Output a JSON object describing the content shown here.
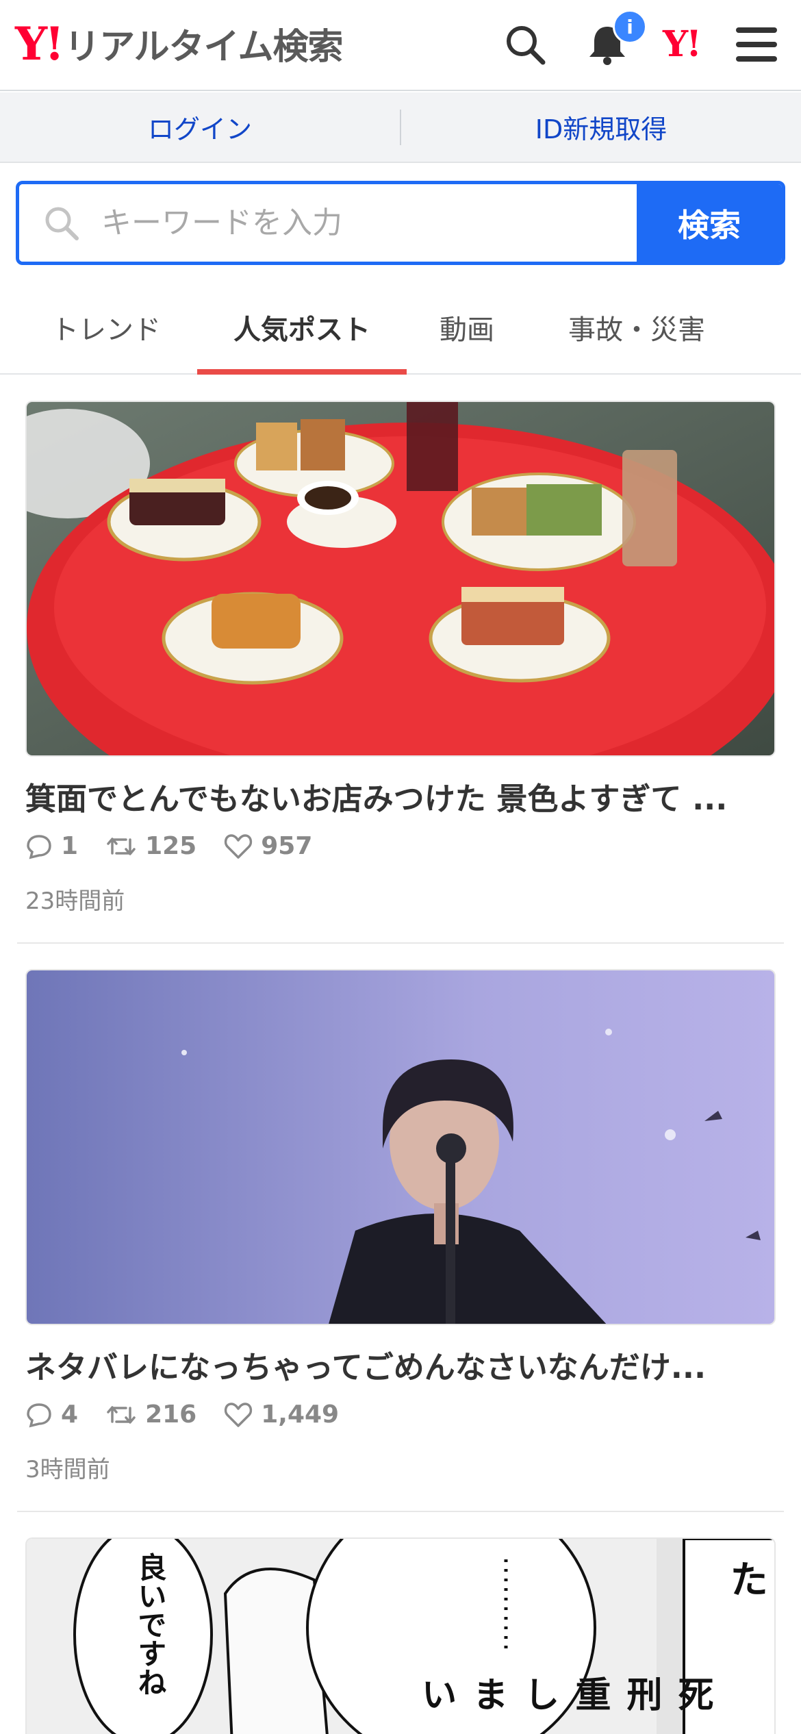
{
  "header": {
    "logo_mark": "Y!",
    "logo_text": "リアルタイム検索",
    "notification_badge": "i",
    "yahoo_mark": "Y!"
  },
  "login_bar": {
    "login": "ログイン",
    "register": "ID新規取得"
  },
  "search": {
    "placeholder": "キーワードを入力",
    "button": "検索"
  },
  "tabs": [
    {
      "label": "トレンド",
      "active": false
    },
    {
      "label": "人気ポスト",
      "active": true
    },
    {
      "label": "動画",
      "active": false
    },
    {
      "label": "事故・災害",
      "active": false
    }
  ],
  "posts": [
    {
      "title": "箕面でとんでもないお店みつけた 景色よすぎて ...",
      "replies": "1",
      "reposts": "125",
      "likes": "957",
      "time": "23時間前"
    },
    {
      "title": "ネタバレになっちゃってごめんなさいなんだけ...",
      "replies": "4",
      "reposts": "216",
      "likes": "1,449",
      "time": "3時間前"
    },
    {
      "manga_text_1": "良いですね",
      "manga_text_2": "死刑重しまい",
      "manga_text_3": "偽物でした"
    }
  ],
  "colors": {
    "brand_red": "#ff0033",
    "accent_blue": "#1e6bf5",
    "link_blue": "#1146c8",
    "tab_underline": "#ea4b48"
  }
}
